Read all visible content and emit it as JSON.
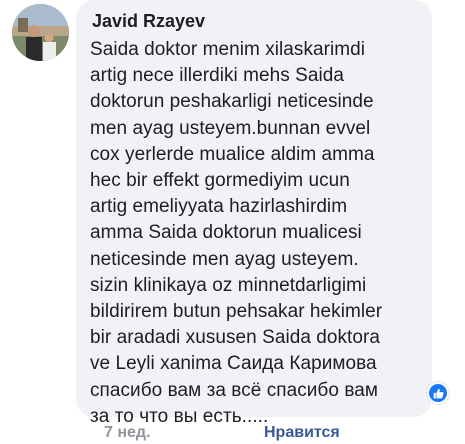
{
  "comment": {
    "author": "Javid Rzayev",
    "text": "Saida doktor menim xilaskarimdi\nartig nece illerdiki mehs Saida\ndoktorun peshakarligi neticesinde\nmen ayag usteyem.bunnan evvel\ncox yerlerde mualice aldim amma\nhec bir effekt gormediyim ucun\nartig emeliyyata hazirlashirdim\namma Saida doktorun mualicesi\nneticesinde men ayag usteyem.\nsizin klinikaya oz minnetdarligimi\nbildirirem butun pehsakar hekimler\nbir aradadi xususen Saida doktora\nve Leyli xanima Саида Каримова\nспасибо вам за всё спасибо вам\nза то что вы есть.....",
    "timestamp": "7 нед.",
    "like_label": "Нравится",
    "reaction_icon": "like-icon"
  },
  "colors": {
    "bubble": "#f0f2f5",
    "link": "#385898",
    "meta": "#90949c",
    "reaction": "#1877f2"
  }
}
